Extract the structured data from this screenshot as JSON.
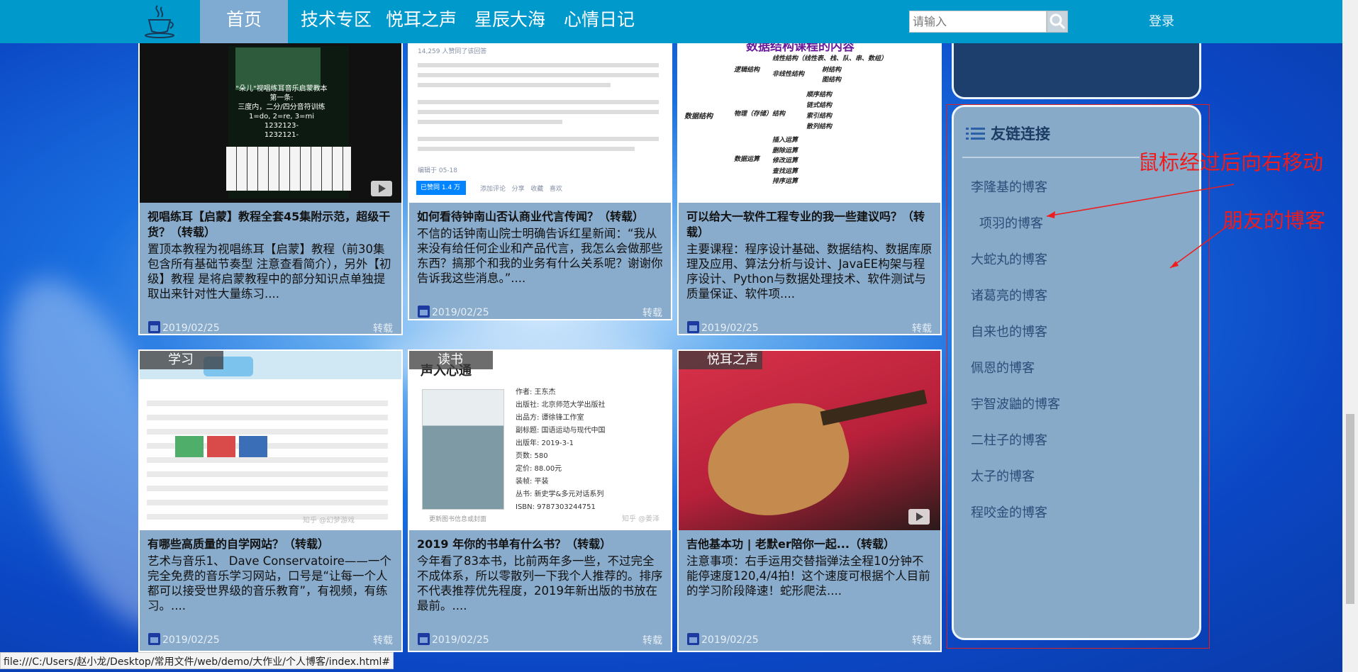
{
  "nav": {
    "items": [
      {
        "label": "首页"
      },
      {
        "label": "技术专区"
      },
      {
        "label": "悦耳之声"
      },
      {
        "label": "星辰大海"
      },
      {
        "label": "心情日记"
      }
    ],
    "search_placeholder": "请输入",
    "login": "登录"
  },
  "cards": [
    {
      "title": "视唱练耳【启蒙】教程全套45集附示范，超级干货？（转载）",
      "desc": "置顶本教程为视唱练耳【启蒙】教程（前30集包含所有基础节奏型 注意查看简介），另外【初级】教程 是将启蒙教程中的部分知识点单独提取出来针对性大量练习....",
      "date": "2019/02/25",
      "tag": "转载",
      "thumb_text": [
        "\"朵儿\"视唱练耳音乐启蒙教本",
        "第一条:",
        "三度内，二分/四分音符训练",
        "1=do, 2=re, 3=mi",
        "1232123-",
        "1232121-"
      ]
    },
    {
      "title": "如何看待钟南山否认商业代言传闻？（转载）",
      "desc": "不信的话钟南山院士明确告诉红星新闻：“我从来没有给任何企业和产品代言，我怎么会做那些东西？搞那个和我的业务有什么关系呢？谢谢你告诉我这些消息。”....",
      "date": "2019/02/25",
      "tag": "转载",
      "thumb_text": [
        "14,259 人赞同了该回答",
        "已赞同 1.4 万",
        "添加评论",
        "分享",
        "收藏",
        "喜欢",
        "编辑于 05-18"
      ]
    },
    {
      "title": "可以给大一软件工程专业的我一些建议吗？（转载）",
      "desc": "主要课程：程序设计基础、数据结构、数据库原理及应用、算法分析与设计、JavaEE构架与程序设计、Python与数据处理技术、软件测试与质量保证、软件项....",
      "date": "2019/02/25",
      "tag": "转载",
      "thumb_text": [
        "数据结构课程的内容",
        "数据结构",
        "逻辑结构",
        "线性结构（线性表、栈、队、串、数组）",
        "非线性结构",
        "树结构",
        "图结构",
        "物理（存储）结构",
        "顺序结构",
        "链式结构",
        "索引结构",
        "散列结构",
        "数据运算",
        "插入运算",
        "删除运算",
        "修改运算",
        "查找运算",
        "排序运算"
      ]
    },
    {
      "ribbon": "学习",
      "title": "有哪些高质量的自学网站？（转载）",
      "desc": "艺术与音乐1、 Dave Conservatoire——一个完全免费的音乐学习网站，口号是“让每一个人都可以接受世界级的音乐教育”，有视频，有练习。....",
      "date": "2019/02/25",
      "tag": "转载",
      "thumb_text": [
        "知乎 @幻梦游戏"
      ]
    },
    {
      "ribbon": "读书",
      "title": "2019 年你的书单有什么书？（转载）",
      "desc": "今年看了83本书，比前两年多一些，不过完全不成体系，所以零散列一下我个人推荐的。排序不代表推荐优先程度，2019年新出版的书放在最前。....",
      "date": "2019/02/25",
      "tag": "转载",
      "thumb_text": [
        "声入心通",
        "作者: 王东杰",
        "出版社: 北京师范大学出版社",
        "出品方: 谭徐锋工作室",
        "副标题: 国语运动与现代中国",
        "出版年: 2019-3-1",
        "页数: 580",
        "定价: 88.00元",
        "装帧: 平装",
        "丛书: 新史学&多元对话系列",
        "ISBN: 9787303244751",
        "更新图书信息或封面",
        "知乎 @姜泽"
      ]
    },
    {
      "ribbon": "悦耳之声",
      "title": "吉他基本功 | 老默er陪你一起...（转载）",
      "desc": "注意事项：右手运用交替指弹法全程10分钟不能停速度120,4/4拍！这个速度可根据个人目前的学习阶段降速！蛇形爬法....",
      "date": "2019/02/25",
      "tag": "转载",
      "thumb_text": []
    }
  ],
  "sidebar": {
    "title": "友链连接",
    "links": [
      "李隆基的博客",
      "项羽的博客",
      "大蛇丸的博客",
      "诸葛亮的博客",
      "自来也的博客",
      "佩恩的博客",
      "宇智波鼬的博客",
      "二柱子的博客",
      "太子的博客",
      "程咬金的博客"
    ]
  },
  "annotations": {
    "hover_note": "鼠标经过后向右移动",
    "friends_note": "朋友的博客",
    "color": "#ee1c1c"
  },
  "status_bar": "file:///C:/Users/赵小龙/Desktop/常用文件/web/demo/大作业/个人博客/index.html#",
  "colors": {
    "nav": "#0099cc",
    "nav_active": "#7faad2",
    "card_bg": "#8aaccc",
    "panel_bg": "#87aac9",
    "panel_dark": "#1c3f6e"
  }
}
